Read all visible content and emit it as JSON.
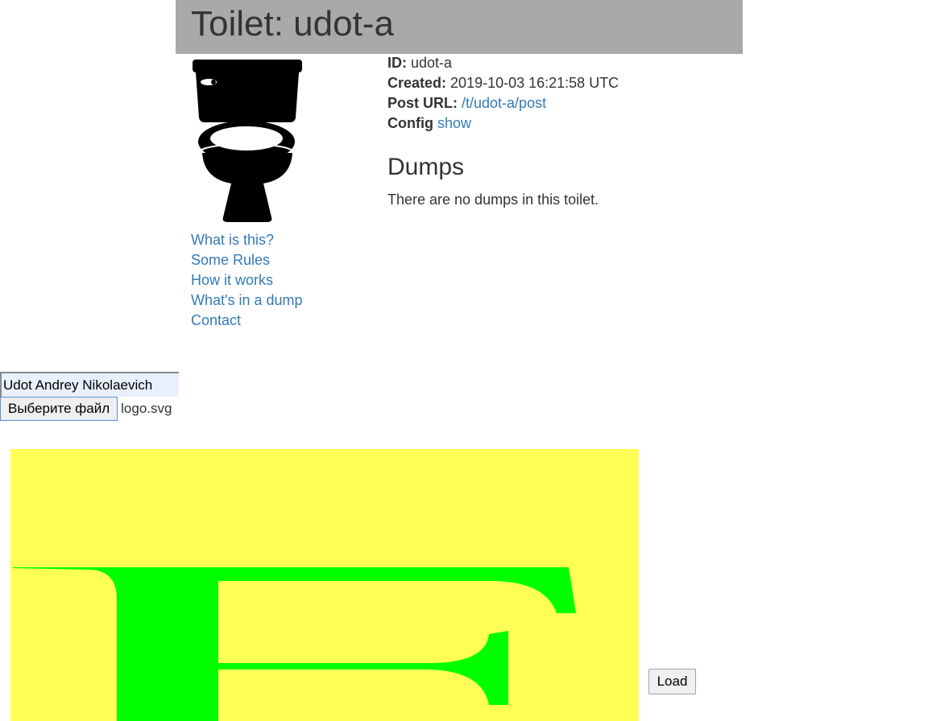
{
  "header": {
    "title": "Toilet: udot-a"
  },
  "toilet_image": {
    "icon": "toilet-icon"
  },
  "nav": {
    "items": [
      {
        "label": "What is this?"
      },
      {
        "label": "Some Rules"
      },
      {
        "label": "How it works"
      },
      {
        "label": "What's in a dump"
      },
      {
        "label": "Contact"
      }
    ]
  },
  "meta": {
    "id_label": "ID:",
    "id_value": "udot-a",
    "created_label": "Created:",
    "created_value": "2019-10-03 16:21:58 UTC",
    "post_url_label": "Post URL:",
    "post_url_value": "/t/udot-a/post",
    "config_label": "Config",
    "config_link": "show"
  },
  "dumps": {
    "heading": "Dumps",
    "empty_text": "There are no dumps in this toilet."
  },
  "form": {
    "name_value": "Udot Andrey Nikolaevich",
    "file_button_label": "Выберите файл",
    "file_name": "logo.svg",
    "load_label": "Load"
  },
  "preview": {
    "background_color": "#ffff55",
    "glyph_color": "#00ff00",
    "glyph": "E"
  }
}
